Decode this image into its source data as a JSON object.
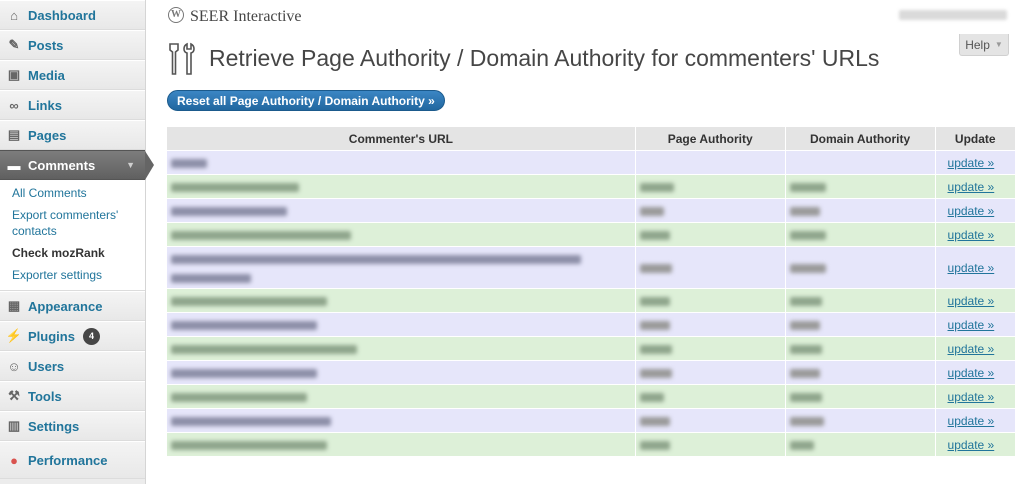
{
  "sidebar": {
    "items_top": [
      {
        "label": "Dashboard",
        "icon": "dashboard-icon"
      },
      {
        "label": "Posts",
        "icon": "pushpin-icon"
      },
      {
        "label": "Media",
        "icon": "media-icon"
      },
      {
        "label": "Links",
        "icon": "link-icon"
      },
      {
        "label": "Pages",
        "icon": "pages-icon"
      },
      {
        "label": "Comments",
        "icon": "comment-icon"
      }
    ],
    "submenu": [
      {
        "label": "All Comments"
      },
      {
        "label": "Export commenters' contacts"
      },
      {
        "label": "Check mozRank"
      },
      {
        "label": "Exporter settings"
      }
    ],
    "items_bottom": [
      {
        "label": "Appearance",
        "icon": "appearance-icon"
      },
      {
        "label": "Plugins",
        "icon": "plugin-icon",
        "badge": "4"
      },
      {
        "label": "Users",
        "icon": "users-icon"
      },
      {
        "label": "Tools",
        "icon": "tools-icon"
      },
      {
        "label": "Settings",
        "icon": "settings-icon"
      },
      {
        "label": "Performance",
        "icon": "performance-icon"
      }
    ]
  },
  "header": {
    "site_name": "SEER Interactive",
    "help_label": "Help"
  },
  "main": {
    "title": "Retrieve Page Authority / Domain Authority for commenters' URLs",
    "reset_button": "Reset all Page Authority / Domain Authority »",
    "table": {
      "columns": [
        "Commenter's URL",
        "Page Authority",
        "Domain Authority",
        "Update"
      ],
      "update_label": "update »",
      "rows": [
        {
          "url_w": 36,
          "pa_w": 0,
          "da_w": 0
        },
        {
          "url_w": 128,
          "pa_w": 34,
          "da_w": 36
        },
        {
          "url_w": 116,
          "pa_w": 24,
          "da_w": 30
        },
        {
          "url_w": 180,
          "pa_w": 30,
          "da_w": 36
        },
        {
          "url_w": 410,
          "url_w2": 80,
          "pa_w": 32,
          "da_w": 36
        },
        {
          "url_w": 156,
          "pa_w": 30,
          "da_w": 32
        },
        {
          "url_w": 146,
          "pa_w": 30,
          "da_w": 30
        },
        {
          "url_w": 186,
          "pa_w": 32,
          "da_w": 32
        },
        {
          "url_w": 146,
          "pa_w": 32,
          "da_w": 30
        },
        {
          "url_w": 136,
          "pa_w": 24,
          "da_w": 32
        },
        {
          "url_w": 160,
          "pa_w": 30,
          "da_w": 34
        },
        {
          "url_w": 156,
          "pa_w": 30,
          "da_w": 24
        }
      ]
    }
  }
}
